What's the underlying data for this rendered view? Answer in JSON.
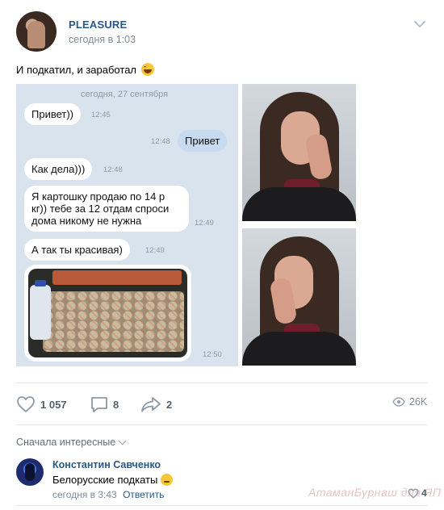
{
  "post": {
    "author": "PLEASURE",
    "time": "сегодня в 1:03",
    "text": "И подкатил, и заработал",
    "text_emoji": "laughing-face-emoji"
  },
  "chat": {
    "date": "сегодня, 27 сентября",
    "messages": [
      {
        "text": "Привет))",
        "time": "12:45",
        "direction": "in"
      },
      {
        "text": "Привет",
        "time": "12:48",
        "direction": "out"
      },
      {
        "text": "Как дела)))",
        "time": "12:48",
        "direction": "in"
      },
      {
        "text_lines": [
          "Я картошку продаю по 14 р",
          "кг)) тебе за 12 отдам спроси",
          "дома никому не нужна"
        ],
        "time": "12:49",
        "direction": "in"
      },
      {
        "text": "А так ты красивая)",
        "time": "12:49",
        "direction": "in"
      },
      {
        "photo": "sack-of-potatoes",
        "time": "12:50",
        "direction": "in"
      }
    ]
  },
  "actions": {
    "likes": "1 057",
    "comments": "8",
    "shares": "2",
    "views": "26K"
  },
  "comments": {
    "sort_label": "Сначала интересные",
    "items": [
      {
        "author": "Константин Савченко",
        "text": "Белорусские подкаты",
        "emoji": "rolling-eyes-emoji",
        "time": "сегодня в 3:43",
        "reply_label": "Ответить",
        "likes": "4"
      }
    ]
  },
  "watermark": "АтаманБурнаш для ЯП",
  "colors": {
    "link": "#2a5885",
    "meta": "#818c99",
    "chat_bg": "#d8e3ee",
    "outgoing_bubble": "#c7daf0"
  }
}
